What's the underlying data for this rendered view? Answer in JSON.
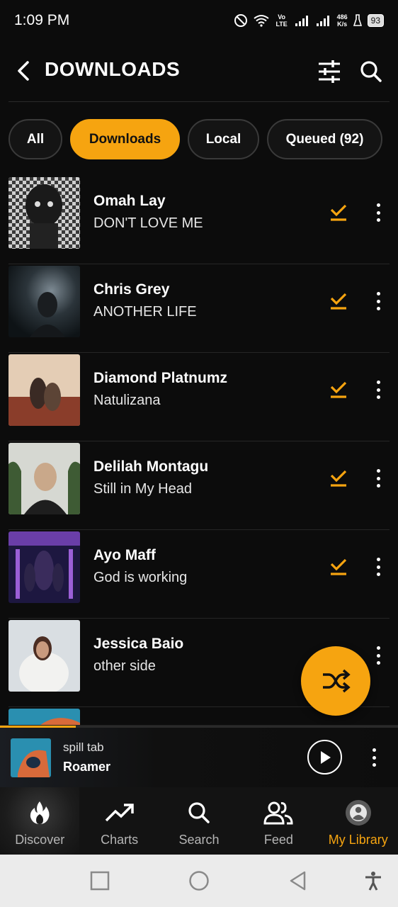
{
  "status_bar": {
    "time": "1:09 PM",
    "net_speed_value": "486",
    "net_speed_unit": "K/s",
    "volte": "Vo LTE",
    "battery": "93"
  },
  "header": {
    "title": "DOWNLOADS"
  },
  "chips": [
    {
      "label": "All",
      "active": false
    },
    {
      "label": "Downloads",
      "active": true
    },
    {
      "label": "Local",
      "active": false
    },
    {
      "label": "Queued (92)",
      "active": false
    }
  ],
  "tracks": [
    {
      "artist": "Omah Lay",
      "title": "DON'T LOVE ME",
      "downloaded": true
    },
    {
      "artist": "Chris Grey",
      "title": "ANOTHER LIFE",
      "downloaded": true
    },
    {
      "artist": "Diamond Platnumz",
      "title": "Natulizana",
      "downloaded": true
    },
    {
      "artist": "Delilah Montagu",
      "title": "Still in My Head",
      "downloaded": true
    },
    {
      "artist": "Ayo Maff",
      "title": "God is working",
      "downloaded": true
    },
    {
      "artist": "Jessica Baio",
      "title": "other side",
      "downloaded": false
    }
  ],
  "shuffle_icon": "shuffle-icon",
  "mini_player": {
    "subtitle": "spill tab",
    "title": "Roamer",
    "progress": 0.19
  },
  "nav": [
    {
      "label": "Discover",
      "icon": "flame-icon",
      "active": false
    },
    {
      "label": "Charts",
      "icon": "trending-up-icon",
      "active": false
    },
    {
      "label": "Search",
      "icon": "search-icon",
      "active": false
    },
    {
      "label": "Feed",
      "icon": "people-icon",
      "active": false
    },
    {
      "label": "My Library",
      "icon": "account-circle-icon",
      "active": true
    }
  ],
  "colors": {
    "accent": "#f6a410",
    "background": "#0c0c0c"
  }
}
